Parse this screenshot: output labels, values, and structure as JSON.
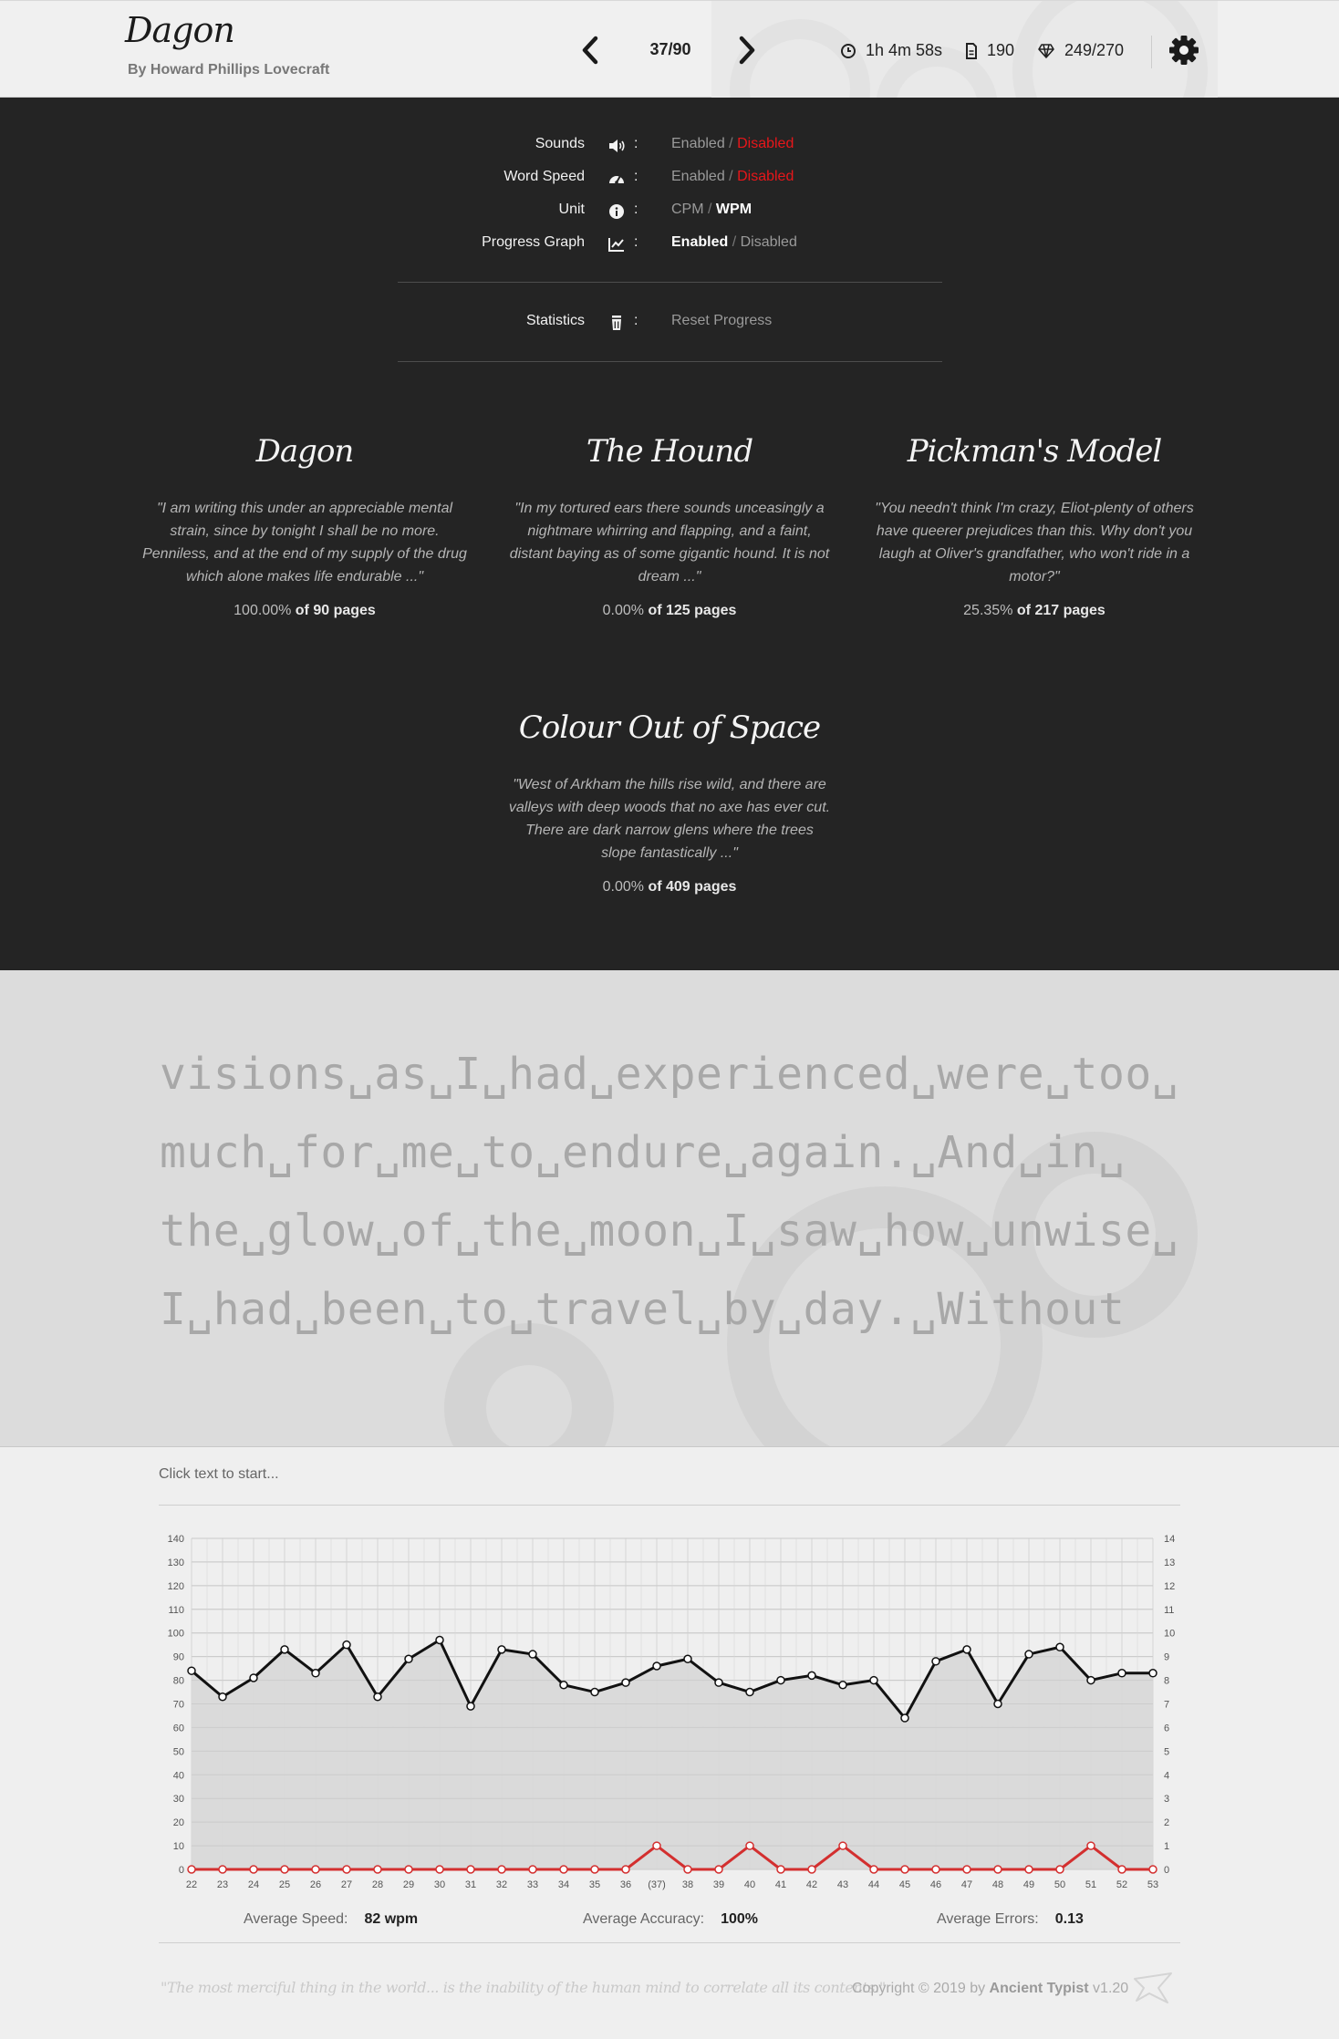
{
  "header": {
    "title": "Dagon",
    "author": "By Howard Phillips Lovecraft",
    "page_counter": "37/90",
    "elapsed_time": "1h 4m 58s",
    "word_count": "190",
    "gems": "249/270"
  },
  "settings": {
    "rows": [
      {
        "label": "Sounds",
        "icon": "speaker-icon",
        "opt1": "Enabled",
        "opt2": "Disabled",
        "selected": "Disabled"
      },
      {
        "label": "Word Speed",
        "icon": "speedometer-icon",
        "opt1": "Enabled",
        "opt2": "Disabled",
        "selected": "Disabled"
      },
      {
        "label": "Unit",
        "icon": "info-icon",
        "opt1": "CPM",
        "opt2": "WPM",
        "selected": "WPM"
      },
      {
        "label": "Progress Graph",
        "icon": "chart-icon",
        "opt1": "Enabled",
        "opt2": "Disabled",
        "selected": "Enabled"
      }
    ],
    "statistics_label": "Statistics",
    "statistics_icon": "trash-icon",
    "reset_label": "Reset Progress",
    "colon": ":",
    "slash": "/"
  },
  "stories": [
    {
      "title": "Dagon",
      "quote": "\"I am writing this under an appreciable mental strain, since by tonight I shall be no more. Penniless, and at the end of my supply of the drug which alone makes life endurable ...\"",
      "percent": "100.00%",
      "of_label": "of",
      "pages": "90 pages"
    },
    {
      "title": "The Hound",
      "quote": "\"In my tortured ears there sounds unceasingly a nightmare whirring and flapping, and a faint, distant baying as of some gigantic hound. It is not dream ...\"",
      "percent": "0.00%",
      "of_label": "of",
      "pages": "125 pages"
    },
    {
      "title": "Pickman's Model",
      "quote": "\"You needn't think I'm crazy, Eliot-plenty of others have queerer prejudices than this. Why don't you laugh at Oliver's grandfather, who won't ride in a motor?\"",
      "percent": "25.35%",
      "of_label": "of",
      "pages": "217 pages"
    },
    {
      "title": "Colour Out of Space",
      "quote": "\"West of Arkham the hills rise wild, and there are valleys with deep woods that no axe has ever cut. There are dark narrow glens where the trees slope fantastically ...\"",
      "percent": "0.00%",
      "of_label": "of",
      "pages": "409 pages"
    }
  ],
  "reading": {
    "lines": [
      "visions␣as␣I␣had␣experienced␣were␣too␣",
      "much␣for␣me␣to␣endure␣again.␣And␣in␣",
      "the␣glow␣of␣the␣moon␣I␣saw␣how␣unwise␣",
      "I␣had␣been␣to␣travel␣by␣day.␣Without"
    ]
  },
  "typing": {
    "hint": "Click text to start..."
  },
  "chart_data": {
    "type": "line",
    "x": [
      "22",
      "23",
      "24",
      "25",
      "26",
      "27",
      "28",
      "29",
      "30",
      "31",
      "32",
      "33",
      "34",
      "35",
      "36",
      "(37)",
      "38",
      "39",
      "40",
      "41",
      "42",
      "43",
      "44",
      "45",
      "46",
      "47",
      "48",
      "49",
      "50",
      "51",
      "52",
      "53"
    ],
    "series": [
      {
        "axis": "left",
        "color": "#111111",
        "values": [
          84,
          73,
          81,
          93,
          83,
          95,
          73,
          89,
          97,
          69,
          93,
          91,
          78,
          75,
          79,
          86,
          89,
          79,
          75,
          80,
          82,
          78,
          80,
          64,
          88,
          93,
          70,
          91,
          94,
          80,
          83,
          83
        ]
      },
      {
        "axis": "right",
        "color": "#d32f2f",
        "values": [
          0,
          0,
          0,
          0,
          0,
          0,
          0,
          0,
          0,
          0,
          0,
          0,
          0,
          0,
          0,
          1,
          0,
          0,
          1,
          0,
          0,
          1,
          0,
          0,
          0,
          0,
          0,
          0,
          0,
          1,
          0,
          0
        ]
      }
    ],
    "left_ticks": [
      "0",
      "10",
      "20",
      "30",
      "40",
      "50",
      "60",
      "70",
      "80",
      "90",
      "100",
      "110",
      "120",
      "130",
      "140"
    ],
    "right_ticks": [
      "0",
      "1",
      "2",
      "3",
      "4",
      "5",
      "6",
      "7",
      "8",
      "9",
      "10",
      "11",
      "12",
      "13",
      "14"
    ],
    "ylim_left": [
      0,
      140
    ],
    "ylim_right": [
      0,
      14
    ],
    "grid": true
  },
  "averages": {
    "speed_label": "Average Speed:",
    "speed_value": "82 wpm",
    "accuracy_label": "Average Accuracy:",
    "accuracy_value": "100%",
    "errors_label": "Average Errors:",
    "errors_value": "0.13"
  },
  "footer": {
    "quote": "\"The most merciful thing in the world... is the inability of the human mind to correlate all its contents.\"",
    "copyright_prefix": "Copyright © 2019 by",
    "brand": "Ancient Typist",
    "version": "v1.20"
  }
}
